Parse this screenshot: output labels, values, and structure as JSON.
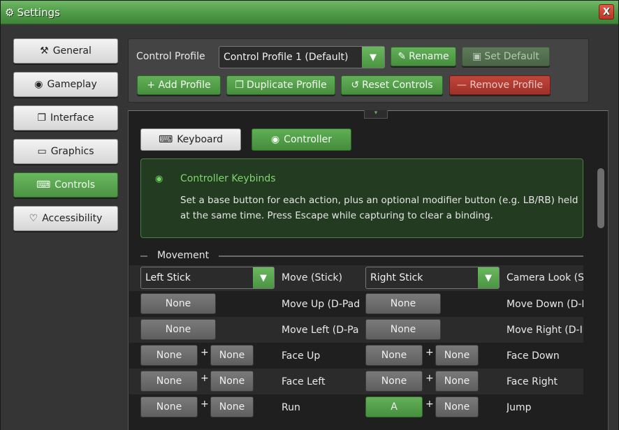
{
  "window": {
    "title": "Settings",
    "close_label": "X"
  },
  "nav": [
    {
      "label": "General",
      "icon": "hammer-icon",
      "glyph": "⚒",
      "active": false
    },
    {
      "label": "Gameplay",
      "icon": "gamepad-icon",
      "glyph": "◉",
      "active": false
    },
    {
      "label": "Interface",
      "icon": "windows-icon",
      "glyph": "❐",
      "active": false
    },
    {
      "label": "Graphics",
      "icon": "monitor-icon",
      "glyph": "▭",
      "active": false
    },
    {
      "label": "Controls",
      "icon": "keyboard-icon",
      "glyph": "⌨",
      "active": true
    },
    {
      "label": "Accessibility",
      "icon": "heart-icon",
      "glyph": "♡",
      "active": false
    }
  ],
  "profile": {
    "label": "Control Profile",
    "selected": "Control Profile 1 (Default)",
    "rename": "Rename",
    "set_default": "Set Default",
    "add": "+ Add Profile",
    "duplicate": "Duplicate Profile",
    "reset": "Reset Controls",
    "remove": "— Remove Profile"
  },
  "tabs": {
    "keyboard": "Keyboard",
    "controller": "Controller",
    "active": "controller"
  },
  "info": {
    "title": "Controller Keybinds",
    "text": "Set a base button for each action, plus an optional modifier button (e.g. LB/RB) held at the same time. Press Escape while capturing to clear a binding."
  },
  "section": {
    "label": "Movement"
  },
  "bindings": {
    "left_stick": {
      "value": "Left Stick",
      "action": "Move (Stick)"
    },
    "right_stick": {
      "value": "Right Stick",
      "action": "Camera Look (S"
    },
    "rows": [
      {
        "left_base": "None",
        "left_action": "Move Up (D-Pad",
        "right_base": "None",
        "right_action": "Move Down (D-I"
      },
      {
        "left_base": "None",
        "left_action": "Move Left (D-Pa",
        "right_base": "None",
        "right_action": "Move Right (D-I"
      },
      {
        "left_base": "None",
        "left_mod": "None",
        "left_action": "Face Up",
        "right_base": "None",
        "right_mod": "None",
        "right_action": "Face Down"
      },
      {
        "left_base": "None",
        "left_mod": "None",
        "left_action": "Face Left",
        "right_base": "None",
        "right_mod": "None",
        "right_action": "Face Right"
      },
      {
        "left_base": "None",
        "left_mod": "None",
        "left_action": "Run",
        "right_base": "A",
        "right_mod": "None",
        "right_action": "Jump"
      }
    ],
    "plus": "+"
  },
  "colors": {
    "accent": "#4e9a46",
    "danger": "#b8382a"
  }
}
